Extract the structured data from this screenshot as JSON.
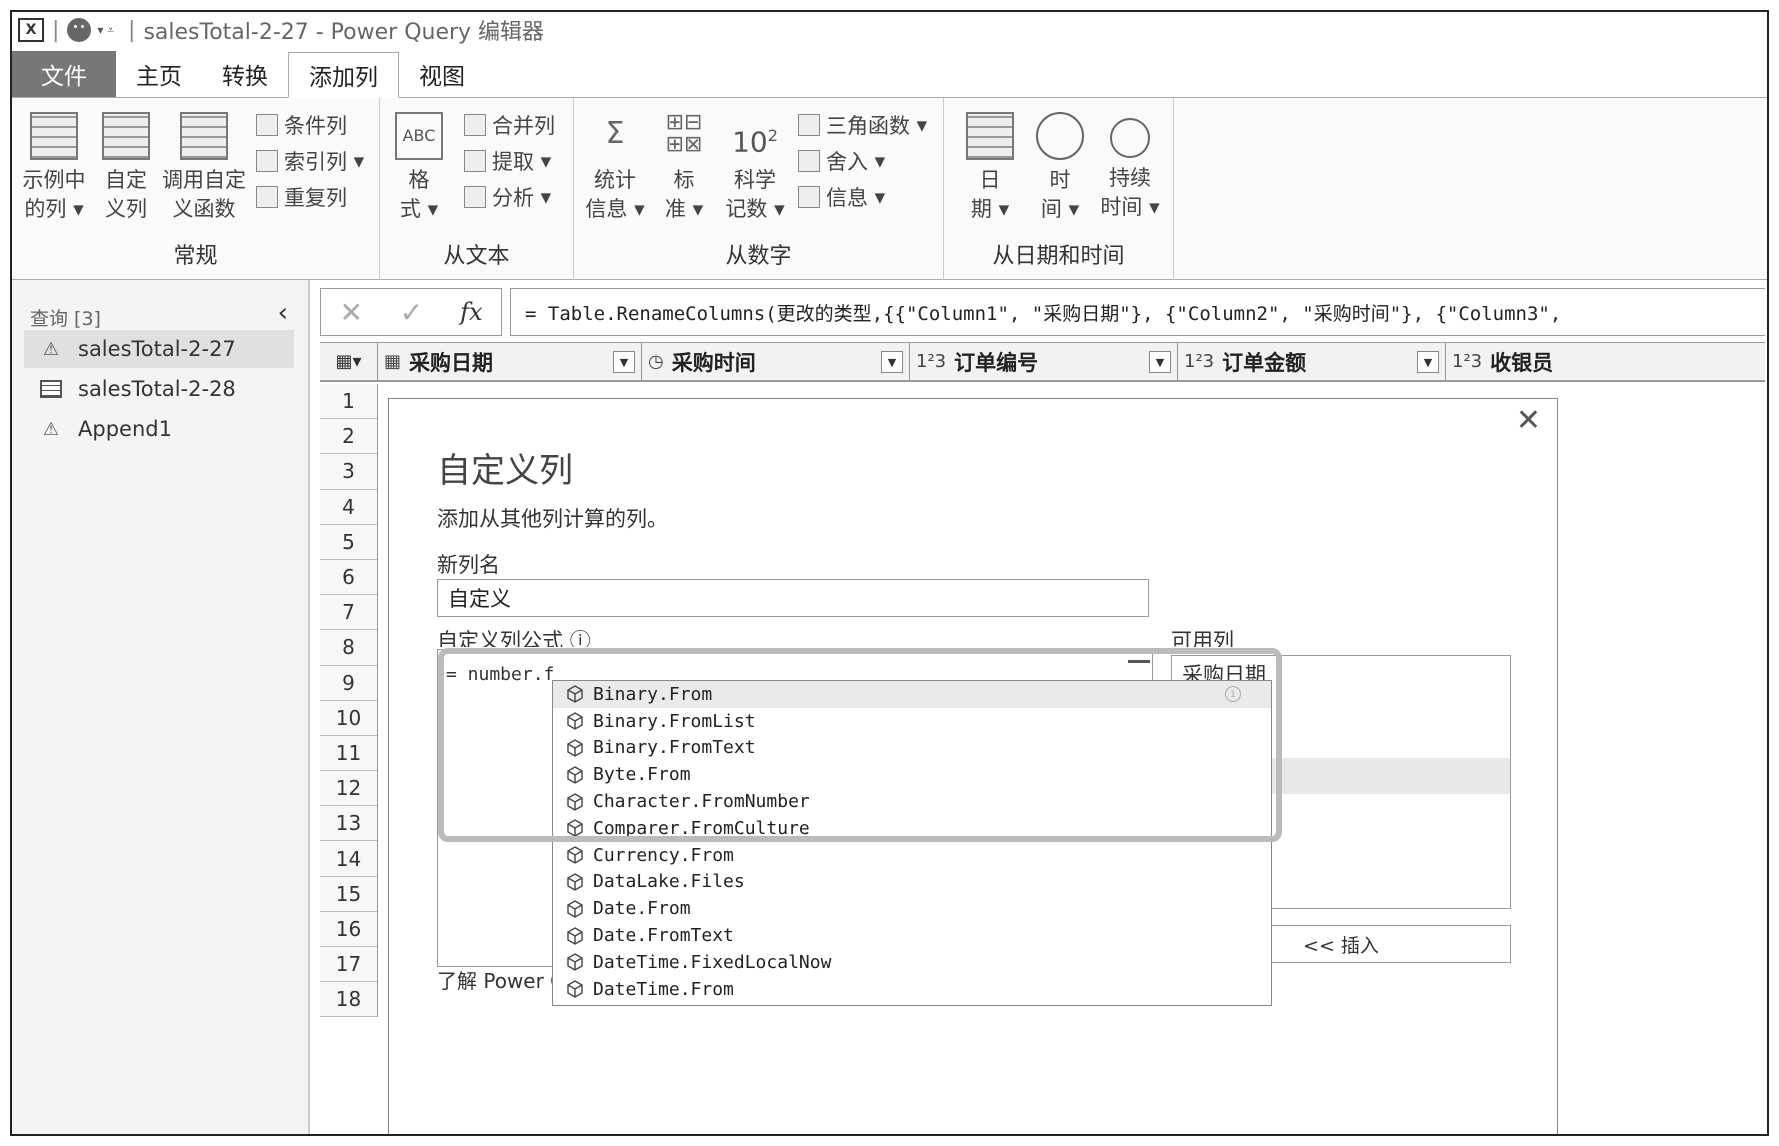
{
  "window": {
    "title": "salesTotal-2-27 - Power Query 编辑器",
    "app_icon": "X"
  },
  "menu": {
    "tabs": [
      "文件",
      "主页",
      "转换",
      "添加列",
      "视图"
    ]
  },
  "ribbon": {
    "groups": [
      {
        "label": "常规",
        "buttons": [
          {
            "label1": "示例中",
            "label2": "的列"
          },
          {
            "label1": "自定",
            "label2": "义列"
          },
          {
            "label1": "调用自定",
            "label2": "义函数"
          }
        ],
        "small": [
          "条件列",
          "索引列",
          "重复列"
        ]
      },
      {
        "label": "从文本",
        "big": {
          "label1": "格",
          "label2": "式"
        },
        "small": [
          "合并列",
          "提取",
          "分析"
        ]
      },
      {
        "label": "从数字",
        "buttons": [
          {
            "label1": "统计",
            "label2": "信息"
          },
          {
            "label1": "标",
            "label2": "准"
          },
          {
            "label1": "科学",
            "label2": "记数"
          }
        ],
        "small": [
          "三角函数",
          "舍入",
          "信息"
        ],
        "sci_icon": "10",
        "sci_exp": "2"
      },
      {
        "label": "从日期和时间",
        "buttons": [
          {
            "label1": "日",
            "label2": "期"
          },
          {
            "label1": "时",
            "label2": "间"
          },
          {
            "label1": "持续",
            "label2": "时间"
          }
        ]
      }
    ]
  },
  "queries": {
    "header": "查询 [3]",
    "items": [
      {
        "name": "salesTotal-2-27",
        "icon": "warning-icon"
      },
      {
        "name": "salesTotal-2-28",
        "icon": "table-icon"
      },
      {
        "name": "Append1",
        "icon": "warning-icon"
      }
    ]
  },
  "formula_bar": {
    "cancel": "✕",
    "confirm": "✓",
    "fx": "fx",
    "text": "= Table.RenameColumns(更改的类型,{{\"Column1\", \"采购日期\"}, {\"Column2\", \"采购时间\"}, {\"Column3\","
  },
  "grid": {
    "columns": [
      {
        "type": "▦",
        "name": "采购日期"
      },
      {
        "type": "◷",
        "name": "采购时间"
      },
      {
        "type": "1²3",
        "name": "订单编号"
      },
      {
        "type": "1²3",
        "name": "订单金额"
      },
      {
        "type": "1²3",
        "name": "收银员"
      }
    ],
    "rows": [
      "1",
      "2",
      "3",
      "4",
      "5",
      "6",
      "7",
      "8",
      "9",
      "10",
      "11",
      "12",
      "13",
      "14",
      "15",
      "16",
      "17",
      "18"
    ]
  },
  "dialog": {
    "title": "自定义列",
    "subtitle": "添加从其他列计算的列。",
    "name_label": "新列名",
    "name_value": "自定义",
    "formula_label": "自定义列公式",
    "formula_value": "= number.f",
    "available_label": "可用列",
    "available": [
      "采购日期"
    ],
    "insert": "<< 插入",
    "learn": "了解 Power Q",
    "close": "✕"
  },
  "autocomplete": {
    "items": [
      "Binary.From",
      "Binary.FromList",
      "Binary.FromText",
      "Byte.From",
      "Character.FromNumber",
      "Comparer.FromCulture",
      "Currency.From",
      "DataLake.Files",
      "Date.From",
      "Date.FromText",
      "DateTime.FixedLocalNow",
      "DateTime.From"
    ]
  }
}
